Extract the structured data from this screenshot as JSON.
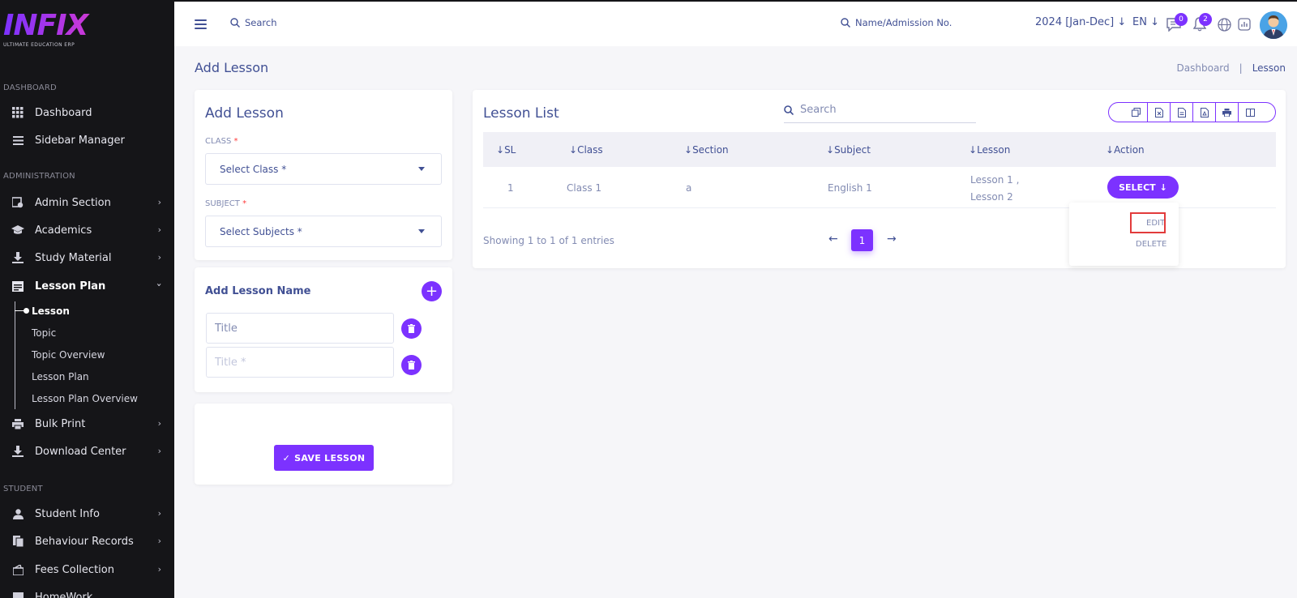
{
  "logo": {
    "text": "INFIX",
    "subtitle": "ULTIMATE EDUCATION ERP"
  },
  "sidebar": {
    "sections": [
      "DASHBOARD",
      "ADMINISTRATION",
      "STUDENT"
    ],
    "items": [
      {
        "label": "Dashboard",
        "icon": "grid-icon"
      },
      {
        "label": "Sidebar Manager",
        "icon": "list-icon"
      },
      {
        "label": "Admin Section",
        "icon": "admin-icon"
      },
      {
        "label": "Academics",
        "icon": "graduation-cap-icon"
      },
      {
        "label": "Study Material",
        "icon": "download-icon"
      },
      {
        "label": "Lesson Plan",
        "icon": "calendar-icon"
      },
      {
        "label": "Bulk Print",
        "icon": "printer-icon"
      },
      {
        "label": "Download Center",
        "icon": "download-icon"
      },
      {
        "label": "Student Info",
        "icon": "user-icon"
      },
      {
        "label": "Behaviour Records",
        "icon": "records-icon"
      },
      {
        "label": "Fees Collection",
        "icon": "wallet-icon"
      },
      {
        "label": "HomeWork",
        "icon": "book-icon"
      }
    ],
    "lesson_plan_sub": [
      "Lesson",
      "Topic",
      "Topic Overview",
      "Lesson Plan",
      "Lesson Plan Overview"
    ]
  },
  "header": {
    "search_label": "Search",
    "student_search_label": "Name/Admission No.",
    "academic_year": "2024 [Jan-Dec]",
    "language": "EN",
    "messages_count": "0",
    "notifications_count": "2"
  },
  "page": {
    "title": "Add Lesson",
    "breadcrumb": [
      "Dashboard",
      "|",
      "Lesson"
    ]
  },
  "add_form": {
    "title": "Add Lesson",
    "class_label": "CLASS",
    "class_placeholder": "Select Class *",
    "subject_label": "SUBJECT",
    "subject_placeholder": "Select Subjects *",
    "required_mark": "*",
    "lesson_name_title": "Add Lesson Name",
    "title_placeholder_1": "Title",
    "title_placeholder_2": "Title *",
    "save_label": "SAVE LESSON"
  },
  "lesson_list": {
    "title": "Lesson List",
    "search_placeholder": "Search",
    "export_icons": [
      "copy-icon",
      "excel-icon",
      "csv-icon",
      "pdf-icon",
      "print-icon",
      "columns-icon"
    ],
    "columns": [
      "SL",
      "Class",
      "Section",
      "Subject",
      "Lesson",
      "Action"
    ],
    "rows": [
      {
        "sl": "1",
        "class": "Class 1",
        "section": "a",
        "subject": "English 1",
        "lesson_line1": "Lesson 1 ,",
        "lesson_line2": "Lesson 2"
      }
    ],
    "action_label": "SELECT",
    "dropdown": [
      "EDIT",
      "DELETE"
    ],
    "entries_info": "Showing 1 to 1 of 1 entries",
    "current_page": "1"
  },
  "colors": {
    "accent": "#7c32ff",
    "sidebar_bg": "#151518",
    "text": "#415094",
    "muted": "#828bb2"
  }
}
